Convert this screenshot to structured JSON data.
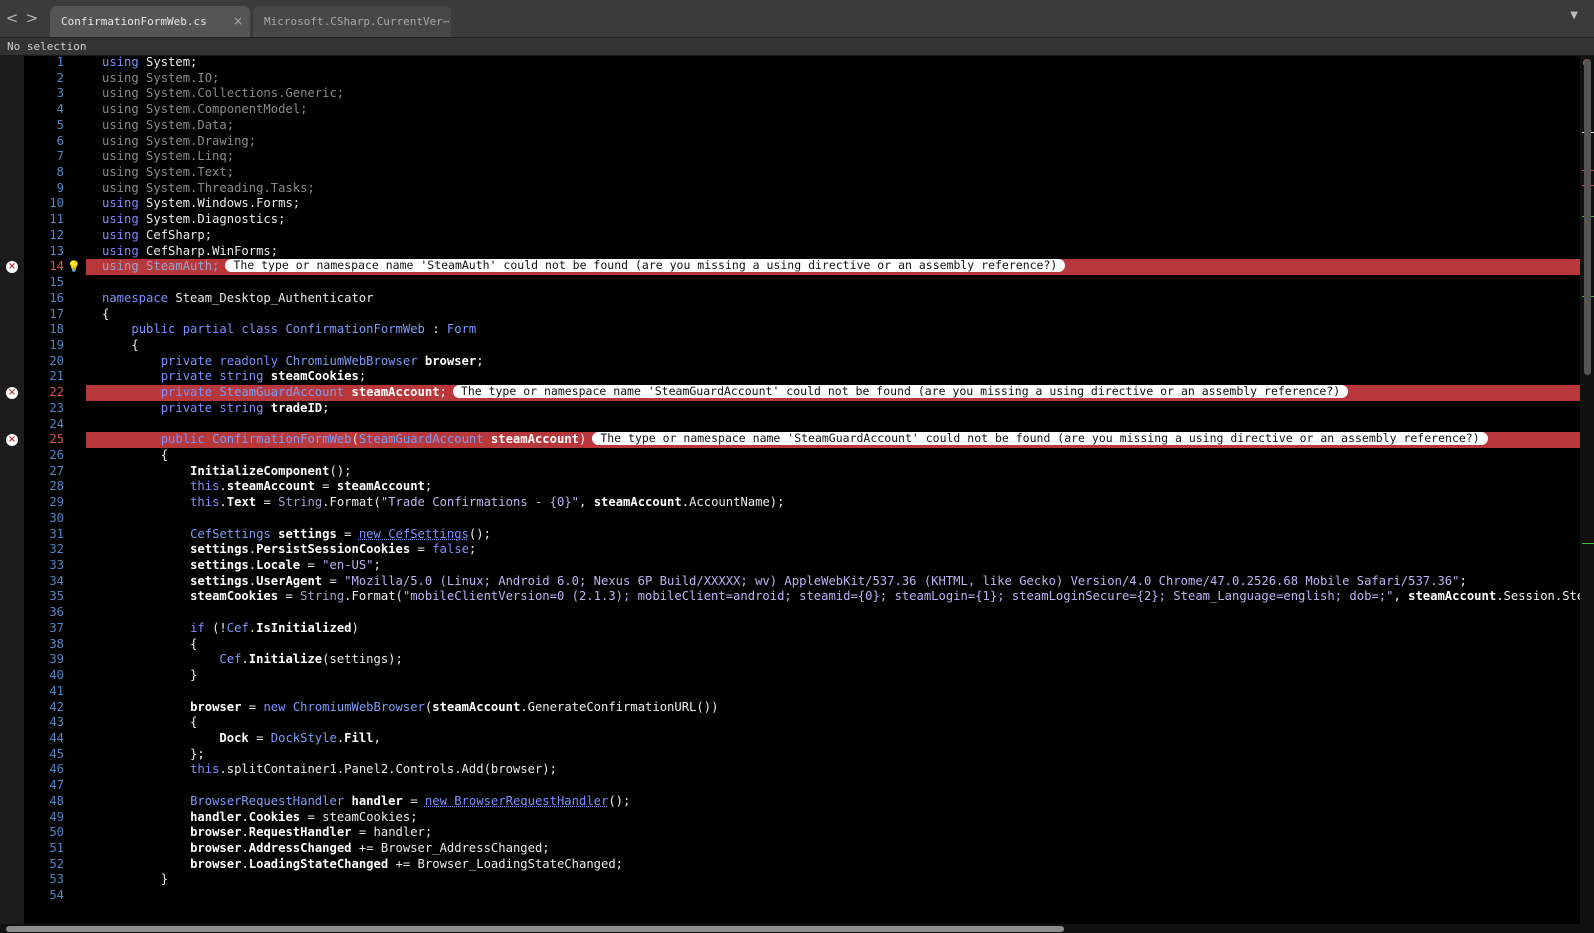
{
  "tabs": {
    "back": "<",
    "forward": ">",
    "active": {
      "label": "ConfirmationFormWeb.cs",
      "close": "×"
    },
    "inactive": {
      "label": "Microsoft.CSharp.CurrentVer⋯"
    },
    "overflow": "▼"
  },
  "pathbar": {
    "text": "No selection"
  },
  "lines": [
    {
      "n": "1",
      "tokens": [
        [
          "kw",
          "using "
        ],
        [
          "plain",
          "System;"
        ]
      ]
    },
    {
      "n": "2",
      "tokens": [
        [
          "dim",
          "using System.IO;"
        ]
      ]
    },
    {
      "n": "3",
      "tokens": [
        [
          "dim",
          "using System.Collections.Generic;"
        ]
      ]
    },
    {
      "n": "4",
      "tokens": [
        [
          "dim",
          "using System.ComponentModel;"
        ]
      ]
    },
    {
      "n": "5",
      "tokens": [
        [
          "dim",
          "using System.Data;"
        ]
      ]
    },
    {
      "n": "6",
      "tokens": [
        [
          "dim",
          "using System.Drawing;"
        ]
      ]
    },
    {
      "n": "7",
      "tokens": [
        [
          "dim",
          "using System.Linq;"
        ]
      ]
    },
    {
      "n": "8",
      "tokens": [
        [
          "dim",
          "using System.Text;"
        ]
      ]
    },
    {
      "n": "9",
      "tokens": [
        [
          "dim",
          "using System.Threading.Tasks;"
        ]
      ]
    },
    {
      "n": "10",
      "tokens": [
        [
          "kw",
          "using "
        ],
        [
          "plain",
          "System.Windows.Forms;"
        ]
      ]
    },
    {
      "n": "11",
      "tokens": [
        [
          "kw",
          "using "
        ],
        [
          "plain",
          "System.Diagnostics;"
        ]
      ]
    },
    {
      "n": "12",
      "tokens": [
        [
          "kw",
          "using "
        ],
        [
          "plain",
          "CefSharp;"
        ]
      ]
    },
    {
      "n": "13",
      "tokens": [
        [
          "kw",
          "using "
        ],
        [
          "plain",
          "CefSharp.WinForms;"
        ]
      ]
    },
    {
      "n": "14",
      "error": true,
      "bulb": true,
      "tokens": [
        [
          "dimtyp",
          "using SteamAuth;"
        ]
      ],
      "message": "The type or namespace name 'SteamAuth' could not be found (are you missing a using directive or an assembly reference?)"
    },
    {
      "n": "15",
      "tokens": []
    },
    {
      "n": "16",
      "tokens": [
        [
          "kw",
          "namespace "
        ],
        [
          "plain",
          "Steam_Desktop_Authenticator"
        ]
      ]
    },
    {
      "n": "17",
      "tokens": [
        [
          "plain",
          "{"
        ]
      ]
    },
    {
      "n": "18",
      "tokens": [
        [
          "plain",
          "    "
        ],
        [
          "kw",
          "public partial class "
        ],
        [
          "typ",
          "ConfirmationFormWeb"
        ],
        [
          "plain",
          " : "
        ],
        [
          "typ",
          "Form"
        ]
      ]
    },
    {
      "n": "19",
      "tokens": [
        [
          "plain",
          "    {"
        ]
      ]
    },
    {
      "n": "20",
      "tokens": [
        [
          "plain",
          "        "
        ],
        [
          "kw",
          "private readonly "
        ],
        [
          "typ",
          "ChromiumWebBrowser "
        ],
        [
          "b",
          "browser"
        ],
        [
          "plain",
          ";"
        ]
      ]
    },
    {
      "n": "21",
      "tokens": [
        [
          "plain",
          "        "
        ],
        [
          "kw",
          "private string "
        ],
        [
          "b",
          "steamCookies"
        ],
        [
          "plain",
          ";"
        ]
      ]
    },
    {
      "n": "22",
      "error": true,
      "tokens": [
        [
          "plain",
          "        "
        ],
        [
          "kw",
          "private "
        ],
        [
          "typ",
          "SteamGuardAccount "
        ],
        [
          "b",
          "steamAccount"
        ],
        [
          "plain",
          ";"
        ]
      ],
      "message": "The type or namespace name 'SteamGuardAccount' could not be found (are you missing a using directive or an assembly reference?)"
    },
    {
      "n": "23",
      "tokens": [
        [
          "plain",
          "        "
        ],
        [
          "kw",
          "private string "
        ],
        [
          "b",
          "tradeID"
        ],
        [
          "plain",
          ";"
        ]
      ]
    },
    {
      "n": "24",
      "tokens": []
    },
    {
      "n": "25",
      "error": true,
      "tokens": [
        [
          "plain",
          "        "
        ],
        [
          "kw",
          "public "
        ],
        [
          "typ",
          "ConfirmationFormWeb"
        ],
        [
          "plain",
          "("
        ],
        [
          "typ",
          "SteamGuardAccount "
        ],
        [
          "b",
          "steamAccount"
        ],
        [
          "plain",
          ")"
        ]
      ],
      "message": "The type or namespace name 'SteamGuardAccount' could not be found (are you missing a using directive or an assembly reference?)"
    },
    {
      "n": "26",
      "tokens": [
        [
          "plain",
          "        {"
        ]
      ]
    },
    {
      "n": "27",
      "tokens": [
        [
          "plain",
          "            "
        ],
        [
          "b",
          "InitializeComponent"
        ],
        [
          "plain",
          "();"
        ]
      ]
    },
    {
      "n": "28",
      "tokens": [
        [
          "plain",
          "            "
        ],
        [
          "kw",
          "this"
        ],
        [
          "plain",
          "."
        ],
        [
          "b",
          "steamAccount"
        ],
        [
          "plain",
          " = "
        ],
        [
          "b",
          "steamAccount"
        ],
        [
          "plain",
          ";"
        ]
      ]
    },
    {
      "n": "29",
      "tokens": [
        [
          "plain",
          "            "
        ],
        [
          "kw",
          "this"
        ],
        [
          "plain",
          "."
        ],
        [
          "b",
          "Text"
        ],
        [
          "plain",
          " = "
        ],
        [
          "dimtyp",
          "String"
        ],
        [
          "plain",
          ".Format("
        ],
        [
          "str",
          "\"Trade Confirmations - {0}\""
        ],
        [
          "plain",
          ", "
        ],
        [
          "b",
          "steamAccount"
        ],
        [
          "plain",
          ".AccountName);"
        ]
      ]
    },
    {
      "n": "30",
      "tokens": []
    },
    {
      "n": "31",
      "tokens": [
        [
          "plain",
          "            "
        ],
        [
          "typ",
          "CefSettings "
        ],
        [
          "b",
          "settings"
        ],
        [
          "plain",
          " = "
        ],
        [
          "kwu",
          "new CefSettings"
        ],
        [
          "plain",
          "();"
        ]
      ]
    },
    {
      "n": "32",
      "tokens": [
        [
          "plain",
          "            "
        ],
        [
          "b",
          "settings"
        ],
        [
          "plain",
          "."
        ],
        [
          "b",
          "PersistSessionCookies"
        ],
        [
          "plain",
          " = "
        ],
        [
          "kw",
          "false"
        ],
        [
          "plain",
          ";"
        ]
      ]
    },
    {
      "n": "33",
      "tokens": [
        [
          "plain",
          "            "
        ],
        [
          "b",
          "settings"
        ],
        [
          "plain",
          "."
        ],
        [
          "b",
          "Locale"
        ],
        [
          "plain",
          " = "
        ],
        [
          "str",
          "\"en-US\""
        ],
        [
          "plain",
          ";"
        ]
      ]
    },
    {
      "n": "34",
      "tokens": [
        [
          "plain",
          "            "
        ],
        [
          "b",
          "settings"
        ],
        [
          "plain",
          "."
        ],
        [
          "b",
          "UserAgent"
        ],
        [
          "plain",
          " = "
        ],
        [
          "str",
          "\"Mozilla/5.0 (Linux; Android 6.0; Nexus 6P Build/XXXXX; wv) AppleWebKit/537.36 (KHTML, like Gecko) Version/4.0 Chrome/47.0.2526.68 Mobile Safari/537.36\""
        ],
        [
          "plain",
          ";"
        ]
      ]
    },
    {
      "n": "35",
      "tokens": [
        [
          "plain",
          "            "
        ],
        [
          "b",
          "steamCookies"
        ],
        [
          "plain",
          " = "
        ],
        [
          "dimtyp",
          "String"
        ],
        [
          "plain",
          ".Format("
        ],
        [
          "str",
          "\"mobileClientVersion=0 (2.1.3); mobileClient=android; steamid={0}; steamLogin={1}; steamLoginSecure={2}; Steam_Language=english; dob=;\""
        ],
        [
          "plain",
          ", "
        ],
        [
          "b",
          "steamAccount"
        ],
        [
          "plain",
          ".Session.SteamID.T"
        ]
      ]
    },
    {
      "n": "36",
      "tokens": []
    },
    {
      "n": "37",
      "tokens": [
        [
          "plain",
          "            "
        ],
        [
          "kw",
          "if "
        ],
        [
          "plain",
          "(!"
        ],
        [
          "typ",
          "Cef"
        ],
        [
          "plain",
          "."
        ],
        [
          "b",
          "IsInitialized"
        ],
        [
          "plain",
          ")"
        ]
      ]
    },
    {
      "n": "38",
      "tokens": [
        [
          "plain",
          "            {"
        ]
      ]
    },
    {
      "n": "39",
      "tokens": [
        [
          "plain",
          "                "
        ],
        [
          "typ",
          "Cef"
        ],
        [
          "plain",
          "."
        ],
        [
          "b",
          "Initialize"
        ],
        [
          "plain",
          "(settings);"
        ]
      ]
    },
    {
      "n": "40",
      "tokens": [
        [
          "plain",
          "            }"
        ]
      ]
    },
    {
      "n": "41",
      "tokens": []
    },
    {
      "n": "42",
      "tokens": [
        [
          "plain",
          "            "
        ],
        [
          "b",
          "browser"
        ],
        [
          "plain",
          " = "
        ],
        [
          "kw",
          "new "
        ],
        [
          "typ",
          "ChromiumWebBrowser"
        ],
        [
          "plain",
          "("
        ],
        [
          "b",
          "steamAccount"
        ],
        [
          "plain",
          ".GenerateConfirmationURL())"
        ]
      ]
    },
    {
      "n": "43",
      "tokens": [
        [
          "plain",
          "            {"
        ]
      ]
    },
    {
      "n": "44",
      "tokens": [
        [
          "plain",
          "                "
        ],
        [
          "b",
          "Dock"
        ],
        [
          "plain",
          " = "
        ],
        [
          "typ",
          "DockStyle"
        ],
        [
          "plain",
          "."
        ],
        [
          "b",
          "Fill"
        ],
        [
          "plain",
          ","
        ]
      ]
    },
    {
      "n": "45",
      "tokens": [
        [
          "plain",
          "            };"
        ]
      ]
    },
    {
      "n": "46",
      "tokens": [
        [
          "plain",
          "            "
        ],
        [
          "kw",
          "this"
        ],
        [
          "plain",
          ".splitContainer1.Panel2.Controls.Add(browser);"
        ]
      ]
    },
    {
      "n": "47",
      "tokens": []
    },
    {
      "n": "48",
      "tokens": [
        [
          "plain",
          "            "
        ],
        [
          "typ",
          "BrowserRequestHandler "
        ],
        [
          "b",
          "handler"
        ],
        [
          "plain",
          " = "
        ],
        [
          "kwu",
          "new BrowserRequestHandler"
        ],
        [
          "plain",
          "();"
        ]
      ]
    },
    {
      "n": "49",
      "tokens": [
        [
          "plain",
          "            "
        ],
        [
          "b",
          "handler"
        ],
        [
          "plain",
          "."
        ],
        [
          "b",
          "Cookies"
        ],
        [
          "plain",
          " = steamCookies;"
        ]
      ]
    },
    {
      "n": "50",
      "tokens": [
        [
          "plain",
          "            "
        ],
        [
          "b",
          "browser"
        ],
        [
          "plain",
          "."
        ],
        [
          "b",
          "RequestHandler"
        ],
        [
          "plain",
          " = handler;"
        ]
      ]
    },
    {
      "n": "51",
      "tokens": [
        [
          "plain",
          "            "
        ],
        [
          "b",
          "browser"
        ],
        [
          "plain",
          "."
        ],
        [
          "b",
          "AddressChanged"
        ],
        [
          "plain",
          " += Browser_AddressChanged;"
        ]
      ]
    },
    {
      "n": "52",
      "tokens": [
        [
          "plain",
          "            "
        ],
        [
          "b",
          "browser"
        ],
        [
          "plain",
          "."
        ],
        [
          "b",
          "LoadingStateChanged"
        ],
        [
          "plain",
          " += Browser_LoadingStateChanged;"
        ]
      ]
    },
    {
      "n": "53",
      "tokens": [
        [
          "plain",
          "        }"
        ]
      ]
    },
    {
      "n": "54",
      "tokens": []
    }
  ],
  "colors": {
    "error": "#b8373a",
    "line_number": "#4f86c6",
    "keyword": "#7e8eff"
  }
}
